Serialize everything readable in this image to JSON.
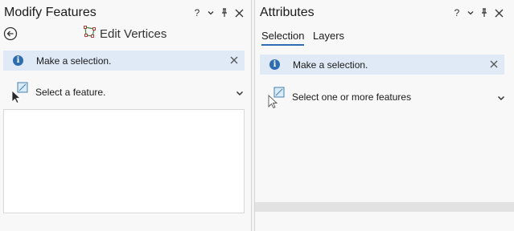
{
  "modify_features": {
    "title": "Modify Features",
    "help_label": "?",
    "tool_label": "Edit Vertices",
    "info_message": "Make a selection.",
    "select_label": "Select a feature."
  },
  "attributes": {
    "title": "Attributes",
    "help_label": "?",
    "tabs": [
      {
        "label": "Selection",
        "active": true
      },
      {
        "label": "Layers",
        "active": false
      }
    ],
    "info_message": "Make a selection.",
    "select_label": "Select one or more features"
  },
  "colors": {
    "accent": "#2c6db4",
    "info_background": "#dfeaf6",
    "pane_background": "#f8f8f8"
  },
  "icons": {
    "back": "arrow-left-circle-icon",
    "edit_vertices": "edit-vertices-icon",
    "info": "info-icon",
    "close": "close-icon",
    "select": "select-feature-icon",
    "chevron": "chevron-down-icon",
    "pin": "pin-icon",
    "menu": "chevron-down-icon"
  }
}
